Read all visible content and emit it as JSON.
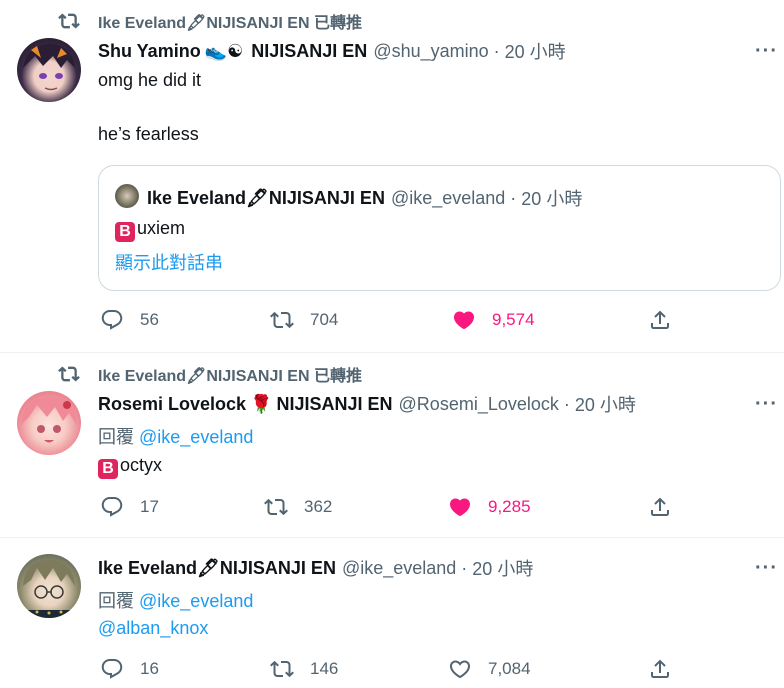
{
  "tweets": [
    {
      "retweet_by": "Ike Eveland🖋NIJISANJI EN 已轉推",
      "name": "Shu Yamino",
      "name_emojis": "👟☯",
      "name_suffix": "NIJISANJI EN",
      "handle": "@shu_yamino",
      "time": "20 小時",
      "lines": [
        "omg he did it",
        "he’s fearless"
      ],
      "quote": {
        "name": "Ike Eveland🖋NIJISANJI EN",
        "handle": "@ike_eveland",
        "time": "20 小時",
        "text": "uxiem",
        "show_thread": "顯示此對話串"
      },
      "replies": "56",
      "retweets": "704",
      "likes": "9,574",
      "liked": true
    },
    {
      "retweet_by": "Ike Eveland🖋NIJISANJI EN 已轉推",
      "name": "Rosemi Lovelock",
      "name_emojis": "🌹",
      "name_suffix": "NIJISANJI EN",
      "handle": "@Rosemi_Lovelock",
      "time": "20 小時",
      "reply_prefix": "回覆",
      "reply_to": "@ike_eveland",
      "text": "octyx",
      "replies": "17",
      "retweets": "362",
      "likes": "9,285",
      "liked": true
    },
    {
      "name": "Ike Eveland🖋NIJISANJI EN",
      "handle": "@ike_eveland",
      "time": "20 小時",
      "reply_prefix": "回覆",
      "reply_to": "@ike_eveland",
      "text": "@alban_knox",
      "replies": "16",
      "retweets": "146",
      "likes": "7,084",
      "liked": false
    }
  ],
  "colors": {
    "accent": "#1d9bf0",
    "like": "#f91880",
    "muted": "#536471",
    "badge": "#e0245e"
  },
  "icons": [
    "retweet-icon",
    "reply-icon",
    "like-icon",
    "share-icon",
    "more-icon"
  ]
}
